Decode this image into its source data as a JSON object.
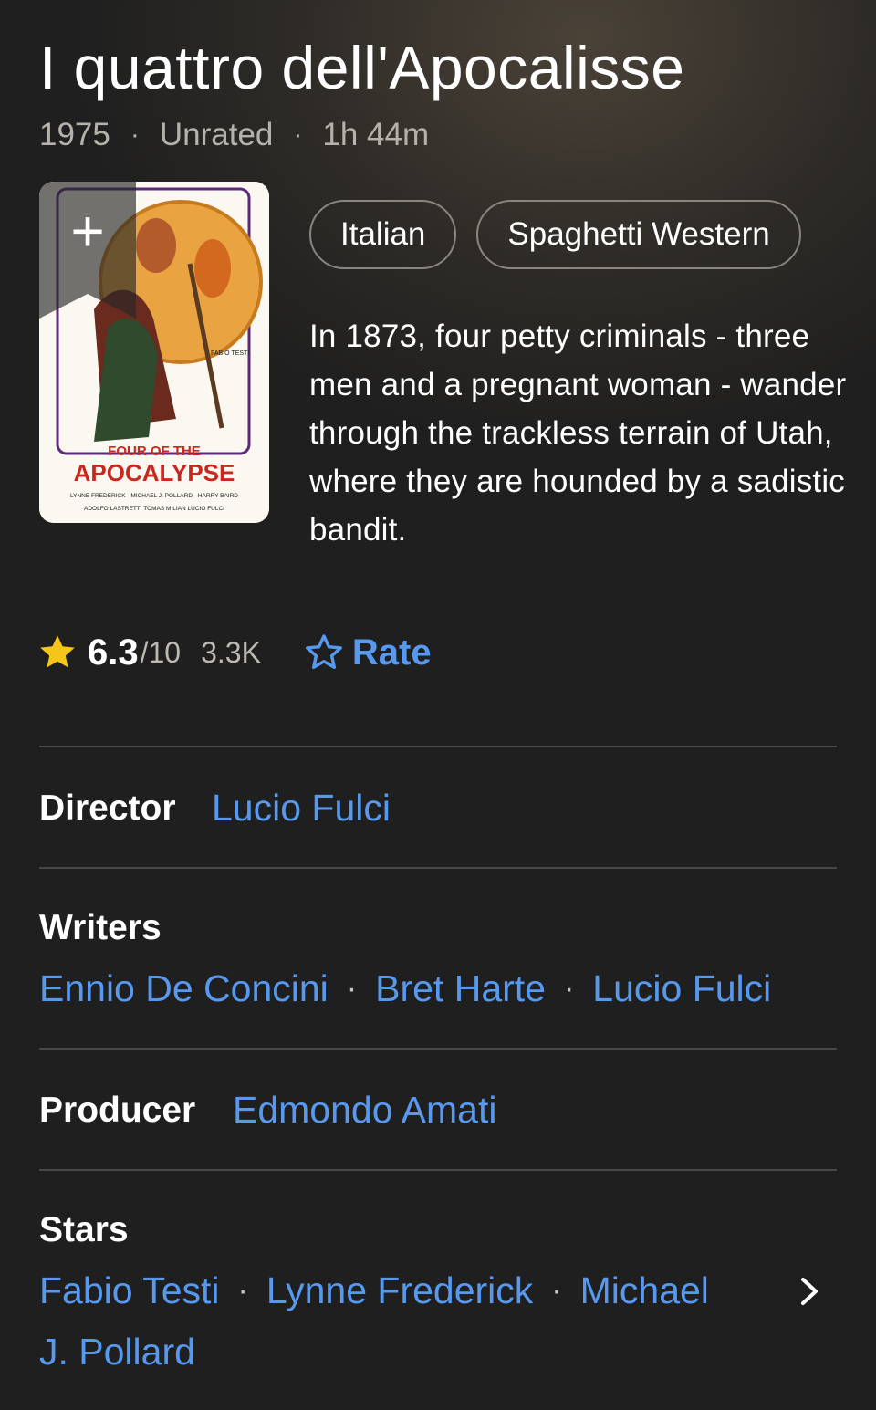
{
  "title": "I quattro dell'Apocalisse",
  "meta": {
    "year": "1975",
    "rating_cert": "Unrated",
    "runtime": "1h 44m"
  },
  "poster": {
    "title_line1": "FOUR OF THE",
    "title_line2": "APOCALYPSE",
    "side_credit": "FABIO TESTI",
    "credits_line1": "LYNNE FREDERICK · MICHAEL J. POLLARD · HARRY BAIRD",
    "credits_line2": "ADOLFO LASTRETTI   TOMAS MILIAN   LUCIO FULCI",
    "add_icon": "plus-icon"
  },
  "genres": [
    "Italian",
    "Spaghetti Western"
  ],
  "plot": "In 1873, four petty criminals - three men and a pregnant woman - wander through the trackless terrain of Utah, where they are hounded by a sadistic bandit.",
  "rating": {
    "score": "6.3",
    "out_of": "/10",
    "votes": "3.3K",
    "rate_label": "Rate",
    "star_color": "#f5c518",
    "accent": "#5799ef"
  },
  "credits": {
    "director_label": "Director",
    "director": "Lucio Fulci",
    "writers_label": "Writers",
    "writers": [
      "Ennio De Concini",
      "Bret Harte",
      "Lucio Fulci"
    ],
    "producer_label": "Producer",
    "producer": "Edmondo Amati",
    "stars_label": "Stars",
    "stars": [
      "Fabio Testi",
      "Lynne Frederick",
      "Michael",
      "J. Pollard"
    ]
  }
}
